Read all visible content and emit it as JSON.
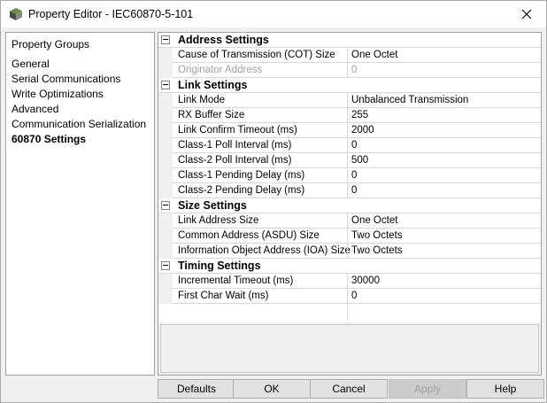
{
  "window": {
    "title": "Property Editor - IEC60870-5-101"
  },
  "property_groups": {
    "header": "Property Groups",
    "items": [
      {
        "label": "General",
        "selected": false
      },
      {
        "label": "Serial Communications",
        "selected": false
      },
      {
        "label": "Write Optimizations",
        "selected": false
      },
      {
        "label": "Advanced",
        "selected": false
      },
      {
        "label": "Communication Serialization",
        "selected": false
      },
      {
        "label": "60870 Settings",
        "selected": true
      }
    ]
  },
  "grid": {
    "categories": [
      {
        "label": "Address Settings",
        "rows": [
          {
            "name": "Cause of Transmission (COT) Size",
            "value": "One Octet",
            "disabled": false
          },
          {
            "name": "Originator Address",
            "value": "0",
            "disabled": true
          }
        ]
      },
      {
        "label": "Link Settings",
        "rows": [
          {
            "name": "Link Mode",
            "value": "Unbalanced Transmission"
          },
          {
            "name": "RX Buffer Size",
            "value": "255"
          },
          {
            "name": "Link Confirm Timeout (ms)",
            "value": "2000"
          },
          {
            "name": "Class-1 Poll Interval (ms)",
            "value": "0"
          },
          {
            "name": "Class-2 Poll Interval (ms)",
            "value": "500"
          },
          {
            "name": "Class-1 Pending Delay (ms)",
            "value": "0"
          },
          {
            "name": "Class-2 Pending Delay (ms)",
            "value": "0"
          }
        ]
      },
      {
        "label": "Size Settings",
        "rows": [
          {
            "name": "Link Address Size",
            "value": "One Octet"
          },
          {
            "name": "Common Address (ASDU) Size",
            "value": "Two Octets"
          },
          {
            "name": "Information Object Address (IOA) Size",
            "value": "Two Octets"
          }
        ]
      },
      {
        "label": "Timing Settings",
        "rows": [
          {
            "name": "Incremental Timeout (ms)",
            "value": "30000"
          },
          {
            "name": "First Char Wait (ms)",
            "value": "0"
          }
        ]
      }
    ]
  },
  "buttons": {
    "defaults": "Defaults",
    "ok": "OK",
    "cancel": "Cancel",
    "apply": "Apply",
    "help": "Help"
  }
}
